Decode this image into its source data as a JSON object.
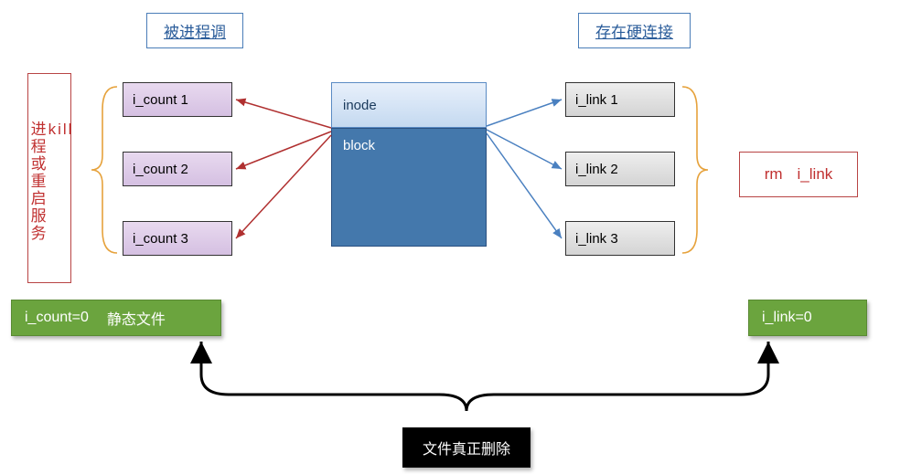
{
  "headers": {
    "left": "被进程调",
    "right": "存在硬连接"
  },
  "center": {
    "inode": "inode",
    "block": "block"
  },
  "i_count": [
    "i_count 1",
    "i_count 2",
    "i_count 3"
  ],
  "i_link": [
    "i_link 1",
    "i_link 2",
    "i_link 3"
  ],
  "left_action": {
    "kill": "kill",
    "rest": "进程或重启服务"
  },
  "right_action": {
    "cmd": "rm",
    "target": "i_link"
  },
  "results": {
    "left_count": "i_count=0",
    "left_label": "静态文件",
    "right": "i_link=0"
  },
  "conclusion": "文件真正删除"
}
